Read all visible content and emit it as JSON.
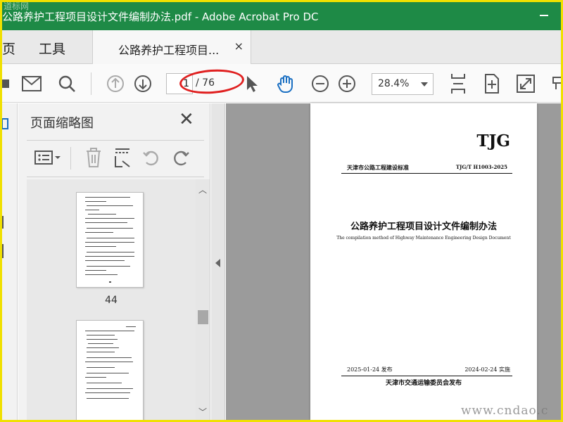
{
  "window": {
    "title": "公路养护工程项目设计文件编制办法.pdf - Adobe Acrobat Pro DC",
    "watermark_logo": "道标网"
  },
  "menu": {
    "home": "页",
    "tools": "工具"
  },
  "tab": {
    "label": "公路养护工程项目...",
    "close": "×"
  },
  "toolbar": {
    "current_page": "1",
    "total_pages": "/ 76",
    "zoom": "28.4%",
    "annotation_color": "#e02020"
  },
  "thumbnails_panel": {
    "title": "页面缩略图",
    "close": "✕",
    "thumbs": [
      {
        "number": "44"
      },
      {
        "number": ""
      }
    ]
  },
  "document_page": {
    "brand": "TJG",
    "standard_name": "天津市公路工程建设标准",
    "code": "TJG/T H1003-2025",
    "title": "公路养护工程项目设计文件编制办法",
    "subtitle": "The compilation method of Highway Maintenance Engineering Design Document",
    "release_date": "2025-01-24 发布",
    "effective_date": "2024-02-24 实施",
    "publisher": "天津市交通运输委员会发布"
  },
  "watermark": "www.cndao.c",
  "colors": {
    "titlebar": "#1e8a46",
    "frame_border": "#f0e000"
  }
}
